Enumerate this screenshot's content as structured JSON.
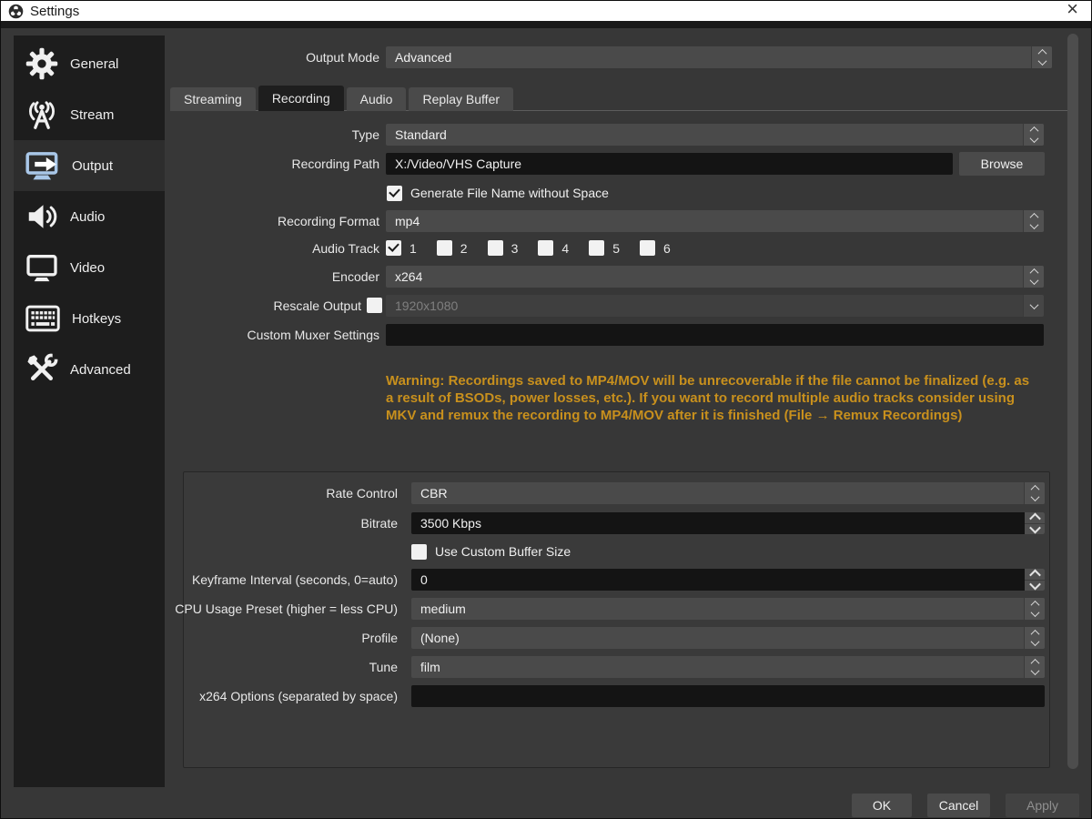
{
  "window": {
    "title": "Settings",
    "close_glyph": "×"
  },
  "sidebar": {
    "items": [
      {
        "label": "General",
        "icon": "gear-icon",
        "selected": false
      },
      {
        "label": "Stream",
        "icon": "broadcast-icon",
        "selected": false
      },
      {
        "label": "Output",
        "icon": "output-monitor-icon",
        "selected": true
      },
      {
        "label": "Audio",
        "icon": "speaker-icon",
        "selected": false
      },
      {
        "label": "Video",
        "icon": "monitor-icon",
        "selected": false
      },
      {
        "label": "Hotkeys",
        "icon": "keyboard-icon",
        "selected": false
      },
      {
        "label": "Advanced",
        "icon": "tools-icon",
        "selected": false
      }
    ]
  },
  "output_mode": {
    "label": "Output Mode",
    "value": "Advanced"
  },
  "tabs": [
    {
      "label": "Streaming",
      "selected": false
    },
    {
      "label": "Recording",
      "selected": true
    },
    {
      "label": "Audio",
      "selected": false
    },
    {
      "label": "Replay Buffer",
      "selected": false
    }
  ],
  "recording": {
    "type": {
      "label": "Type",
      "value": "Standard"
    },
    "recording_path": {
      "label": "Recording Path",
      "value": "X:/Video/VHS Capture",
      "browse_label": "Browse"
    },
    "generate_no_space": {
      "label": "Generate File Name without Space",
      "checked": true
    },
    "recording_format": {
      "label": "Recording Format",
      "value": "mp4"
    },
    "audio_track": {
      "label": "Audio Track",
      "tracks": [
        {
          "label": "1",
          "checked": true
        },
        {
          "label": "2",
          "checked": false
        },
        {
          "label": "3",
          "checked": false
        },
        {
          "label": "4",
          "checked": false
        },
        {
          "label": "5",
          "checked": false
        },
        {
          "label": "6",
          "checked": false
        }
      ]
    },
    "encoder": {
      "label": "Encoder",
      "value": "x264"
    },
    "rescale_output": {
      "label": "Rescale Output",
      "checked": false,
      "value": "1920x1080",
      "disabled": true
    },
    "custom_muxer": {
      "label": "Custom Muxer Settings",
      "value": ""
    },
    "warning": "Warning: Recordings saved to MP4/MOV will be unrecoverable if the file cannot be finalized (e.g. as a result of BSODs, power losses, etc.). If you want to record multiple audio tracks consider using MKV and remux the recording to MP4/MOV after it is finished (File → Remux Recordings)"
  },
  "encoder_settings": {
    "rate_control": {
      "label": "Rate Control",
      "value": "CBR"
    },
    "bitrate": {
      "label": "Bitrate",
      "value": "3500 Kbps"
    },
    "use_custom_buffer": {
      "label": "Use Custom Buffer Size",
      "checked": false
    },
    "keyframe_interval": {
      "label": "Keyframe Interval (seconds, 0=auto)",
      "value": "0"
    },
    "cpu_preset": {
      "label": "CPU Usage Preset (higher = less CPU)",
      "value": "medium"
    },
    "profile": {
      "label": "Profile",
      "value": "(None)"
    },
    "tune": {
      "label": "Tune",
      "value": "film"
    },
    "x264_options": {
      "label": "x264 Options (separated by space)",
      "value": ""
    }
  },
  "footer": {
    "ok": "OK",
    "cancel": "Cancel",
    "apply": "Apply",
    "apply_disabled": true
  },
  "colors": {
    "accent_icon_blue": "#a9c7e8",
    "warning_text": "#c8901d",
    "titlebar_bg": "#ffffff",
    "window_bg": "#373737",
    "sidebar_bg": "#1d1d1d",
    "control_bg": "#4a4a4a",
    "input_bg": "#141414"
  }
}
